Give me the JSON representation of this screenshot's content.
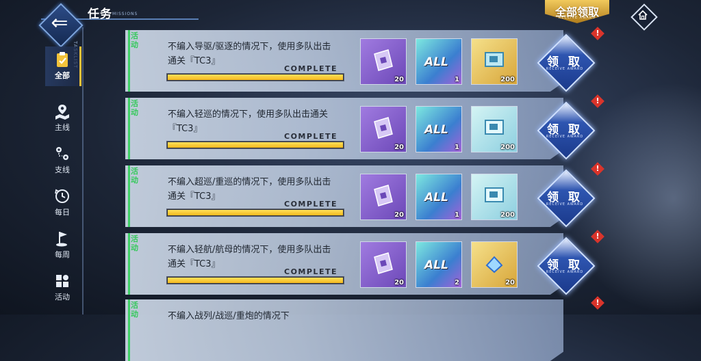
{
  "header": {
    "back_glyph": "⇐",
    "title": "任务",
    "title_sub": "MISSIONS",
    "receive_all": "全部领取",
    "receive_all_sub": "RECEIVE AWARD",
    "home_icon": "home-icon"
  },
  "sidebar": {
    "tasklist_label": "TASKLIST",
    "items": [
      {
        "label": "全部",
        "icon": "clipboard-icon",
        "active": true
      },
      {
        "label": "主线",
        "icon": "map-pin-icon",
        "active": false
      },
      {
        "label": "支线",
        "icon": "route-icon",
        "active": false
      },
      {
        "label": "每日",
        "icon": "clock-icon",
        "active": false
      },
      {
        "label": "每周",
        "icon": "flag-icon",
        "active": false
      },
      {
        "label": "活动",
        "icon": "grid-icon",
        "active": false
      }
    ]
  },
  "tasks": [
    {
      "tag": "活动",
      "description": "不编入导驱/驱逐的情况下，使用多队出击通关『TC3』",
      "status": "COMPLETE",
      "progress": 1.0,
      "rewards": [
        {
          "type": "purple",
          "count": "20"
        },
        {
          "type": "teal",
          "text": "ALL",
          "count": "1"
        },
        {
          "type": "gold",
          "count": "200"
        }
      ],
      "claim": "领 取",
      "claim_sub": "RECEIVE AWARD"
    },
    {
      "tag": "活动",
      "description": "不编入轻巡的情况下，使用多队出击通关『TC3』",
      "status": "COMPLETE",
      "progress": 1.0,
      "rewards": [
        {
          "type": "purple",
          "count": "20"
        },
        {
          "type": "teal",
          "text": "ALL",
          "count": "1"
        },
        {
          "type": "teal",
          "count": "200"
        }
      ],
      "claim": "领 取",
      "claim_sub": "RECEIVE AWARD"
    },
    {
      "tag": "活动",
      "description": "不编入超巡/重巡的情况下，使用多队出击通关『TC3』",
      "status": "COMPLETE",
      "progress": 1.0,
      "rewards": [
        {
          "type": "purple",
          "count": "20"
        },
        {
          "type": "teal",
          "text": "ALL",
          "count": "1"
        },
        {
          "type": "teal",
          "count": "200"
        }
      ],
      "claim": "领 取",
      "claim_sub": "RECEIVE AWARD"
    },
    {
      "tag": "活动",
      "description": "不编入轻航/航母的情况下，使用多队出击通关『TC3』",
      "status": "COMPLETE",
      "progress": 1.0,
      "rewards": [
        {
          "type": "purple",
          "count": "20"
        },
        {
          "type": "teal",
          "text": "ALL",
          "count": "2"
        },
        {
          "type": "gold",
          "count": "20"
        }
      ],
      "claim": "领 取",
      "claim_sub": "RECEIVE AWARD"
    },
    {
      "tag": "活动",
      "description": "不编入战列/战巡/重炮的情况下",
      "status": "",
      "progress": 1.0,
      "rewards": [],
      "claim": "",
      "claim_sub": ""
    }
  ],
  "colors": {
    "accent_gold": "#f2c23a",
    "tag_green": "#36c95c",
    "alert_red": "#d9342b"
  }
}
